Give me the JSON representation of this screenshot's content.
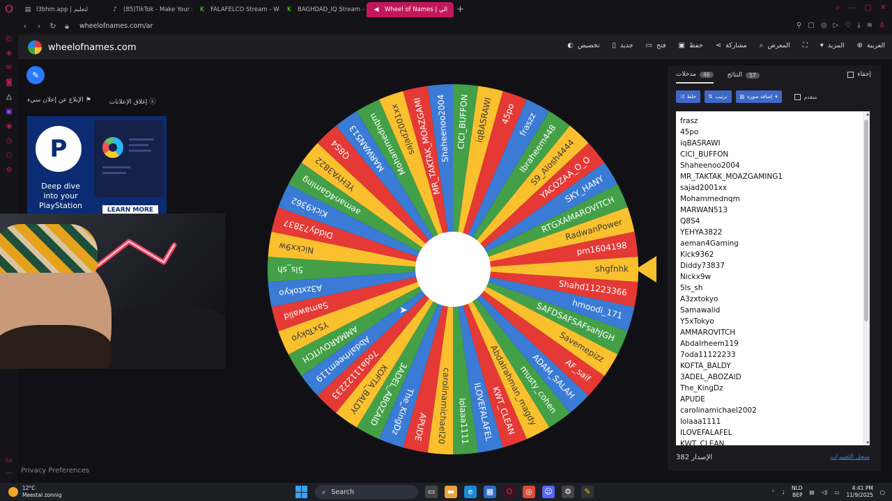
{
  "browser": {
    "tabs": [
      {
        "title": "l3bhm.app | لتعليم",
        "icon": "page-icon",
        "active": false
      },
      {
        "title": "(85)TikTok - Make Your D",
        "icon": "tiktok-icon",
        "active": false
      },
      {
        "title": "FALAFELCO Stream - Wa",
        "icon": "kick-icon",
        "active": false
      },
      {
        "title": "BAGHDAD_IQ Stream - W",
        "icon": "kick-icon",
        "active": false
      },
      {
        "title": "Wheel of Names | الي",
        "icon": "audio-icon",
        "active": true
      }
    ],
    "url": "wheelofnames.com/ar",
    "accent": "#c2185b"
  },
  "site": {
    "name": "wheelofnames.com",
    "menu": [
      {
        "label": "العربية",
        "icon": "globe-icon"
      },
      {
        "label": "المزيد",
        "icon": "chevron-down-icon"
      },
      {
        "label": "",
        "icon": "fullscreen-icon"
      },
      {
        "label": "المعرض",
        "icon": "search-icon"
      },
      {
        "label": "مشاركة",
        "icon": "share-icon"
      },
      {
        "label": "حفظ",
        "icon": "save-icon"
      },
      {
        "label": "فتح",
        "icon": "folder-icon"
      },
      {
        "label": "جديد",
        "icon": "file-icon"
      },
      {
        "label": "تخصيص",
        "icon": "palette-icon"
      }
    ]
  },
  "ads": {
    "report": "الإبلاغ عن إعلان سيء",
    "close": "إغلاق الإعلانات",
    "text": "Deep dive into your PlayStation",
    "cta": "LEARN MORE"
  },
  "wheel": {
    "colors": [
      "#fbc02d",
      "#e53935",
      "#3a7bd5",
      "#43a047"
    ],
    "pointer_color": "#fbc02d",
    "labels": [
      "shgfnhk",
      "Shahd11223366",
      "hmoodi_171",
      "SAFDSAFSAFsahJGH",
      "Savemepizz",
      "AF_saif",
      "ADAM_SALAH",
      "musty_cohen",
      "Abdalrahman_magdy",
      "KWT_CLEAN",
      "ILOVEFALAFEL",
      "lolaaa1111",
      "carolinamichael20",
      "APUDE",
      "The_KingDz",
      "3ADEL_ABOZAID",
      "KOFTA_BALDY",
      "7oda11122233",
      "Abdalrheem119",
      "AMMAROVITCH",
      "Y5xTokyo",
      "Samawalid",
      "A3zxtokyo",
      "5ls_sh",
      "Nickx9w",
      "Diddy73837",
      "Kick9362",
      "aeman4Gaming",
      "YEHYA3822",
      "Q8S4",
      "MARWAN513",
      "Mohammednqm",
      "sajad2001xx",
      "MR_TAKTAK_MOAZGAMI",
      "Shaheenoo2004",
      "CICI_BUFFON",
      "iqBASRAWI",
      "45po",
      "fraszz",
      "Ibraheem448",
      "S9_Alosh4444",
      "YACOZAA_O_O",
      "SKY_HANY",
      "RTGXAMAROVITCH",
      "RadwanPower",
      "pm1604198"
    ]
  },
  "panel": {
    "tab_entries": "مدخلات",
    "entries_count": "46",
    "tab_results": "النتائج",
    "results_count": "57",
    "hide": "إخفاء",
    "shuffle": "خلط",
    "sort": "ترتيب",
    "add_image": "إضافة صورة",
    "advanced": "متقدم",
    "entries": [
      "frasz",
      "45po",
      "iqBASRAWI",
      "CICI_BUFFON",
      "Shaheenoo2004",
      "MR_TAKTAK_MOAZGAMING1",
      "sajad2001xx",
      "Mohammednqm",
      "MARWAN513",
      "Q8S4",
      "YEHYA3822",
      "aeman4Gaming",
      "Kick9362",
      "Diddy73837",
      "Nickx9w",
      "5ls_sh",
      "A3zxtokyo",
      "Samawalid",
      "Y5xTokyo",
      "AMMAROVITCH",
      "Abdalrheem119",
      "7oda11122233",
      "KOFTA_BALDY",
      "3ADEL_ABOZAID",
      "The_KingDz",
      "APUDE",
      "carolinamichael2002",
      "lolaaa1111",
      "ILOVEFALAFEL",
      "KWT_CLEAN"
    ],
    "version_label": "الإصدار",
    "version": "382",
    "changelog": "سجل التغييرات"
  },
  "privacy": "Privacy Preferences",
  "taskbar": {
    "temp": "12°C",
    "weather": "Meestal zonnig",
    "search": "Search",
    "lang1": "NLD",
    "lang2": "BEP",
    "time": "4:41 PM",
    "date": "11/9/2025"
  }
}
